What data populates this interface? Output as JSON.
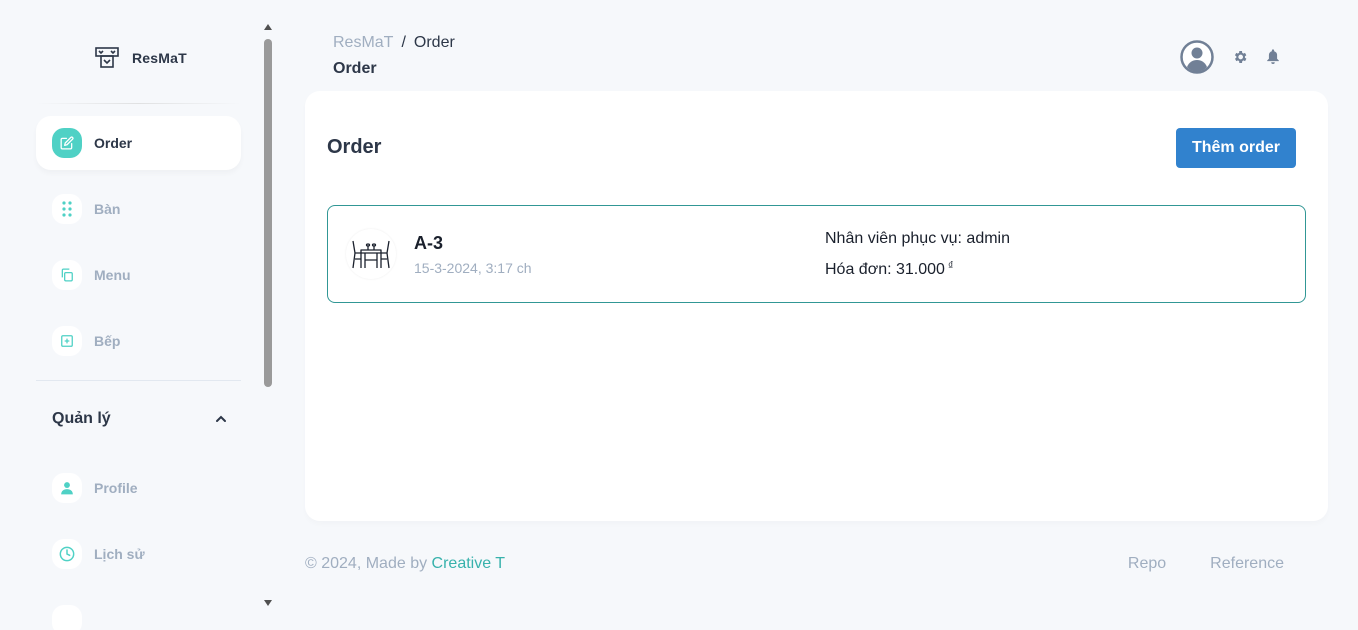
{
  "brand": {
    "name": "ResMaT",
    "logo_icon": "restaurant-logo-icon"
  },
  "sidebar": {
    "items": [
      {
        "label": "Order",
        "icon": "edit-icon",
        "active": true
      },
      {
        "label": "Bàn",
        "icon": "grid-dots-icon",
        "active": false
      },
      {
        "label": "Menu",
        "icon": "copy-icon",
        "active": false
      },
      {
        "label": "Bếp",
        "icon": "plus-square-icon",
        "active": false
      }
    ],
    "section": {
      "title": "Quản lý",
      "icon": "chevron-up-icon"
    },
    "section_items": [
      {
        "label": "Profile",
        "icon": "person-icon"
      },
      {
        "label": "Lịch sử",
        "icon": "clock-icon"
      }
    ]
  },
  "breadcrumb": {
    "root": "ResMaT",
    "separator": "/",
    "current": "Order"
  },
  "header": {
    "title": "Order"
  },
  "card": {
    "title": "Order",
    "add_button": "Thêm order",
    "orders": [
      {
        "table": "A-3",
        "time": "15-3-2024, 3:17 ch",
        "staff": "Nhân viên phục vụ: admin",
        "bill": "Hóa đơn: 31.000",
        "currency": "₫",
        "icon": "dining-table-icon"
      }
    ]
  },
  "footer": {
    "copyright_prefix": "© 2024, Made by ",
    "copyright_brand": "Creative T",
    "links": [
      "Repo",
      "Reference"
    ]
  },
  "colors": {
    "accent_teal": "#4fd1c5",
    "primary_blue": "#3182ce",
    "order_border": "#319795",
    "muted_text": "#a0aec0",
    "page_bg": "#f6f8fb"
  }
}
